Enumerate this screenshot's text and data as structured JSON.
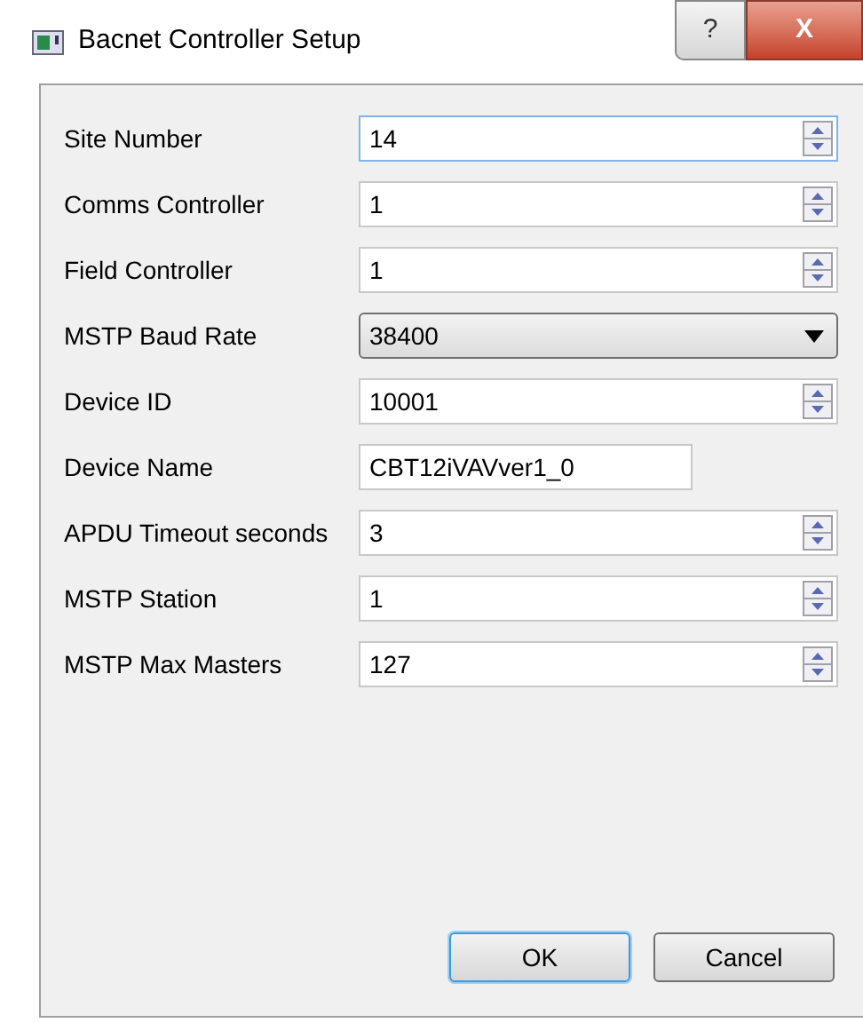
{
  "window": {
    "title": "Bacnet Controller Setup",
    "controls": [
      "?",
      "X"
    ]
  },
  "fields": [
    {
      "label": "Site Number",
      "kind": "spin",
      "value": "14",
      "focused": true
    },
    {
      "label": "Comms Controller",
      "kind": "spin",
      "value": "1",
      "focused": false
    },
    {
      "label": "Field Controller",
      "kind": "spin",
      "value": "1",
      "focused": false
    },
    {
      "label": "MSTP Baud Rate",
      "kind": "combo",
      "value": "38400",
      "focused": false
    },
    {
      "label": "Device ID",
      "kind": "spin",
      "value": "10001",
      "focused": false
    },
    {
      "label": "Device Name",
      "kind": "text",
      "value": "CBT12iVAVver1_0",
      "focused": false
    },
    {
      "label": "APDU Timeout seconds",
      "kind": "spin",
      "value": "3",
      "focused": false
    },
    {
      "label": "MSTP Station",
      "kind": "spin",
      "value": "1",
      "focused": false
    },
    {
      "label": "MSTP Max Masters",
      "kind": "spin",
      "value": "127",
      "focused": false
    }
  ],
  "buttons": [
    {
      "label": "OK",
      "default": true
    },
    {
      "label": "Cancel",
      "default": false
    }
  ]
}
